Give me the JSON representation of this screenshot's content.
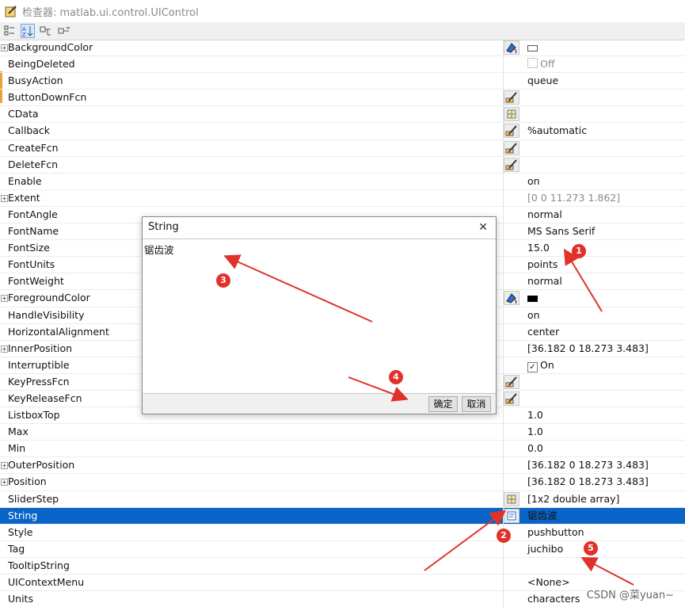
{
  "window": {
    "title": "检查器:  matlab.ui.control.UIControl"
  },
  "properties": [
    {
      "name": "BackgroundColor",
      "expand": true,
      "btn": "color-picker-icon",
      "val": "",
      "swatch": "white"
    },
    {
      "name": "BeingDeleted",
      "check": "off",
      "val": "Off",
      "gray": true
    },
    {
      "name": "BusyAction",
      "val": "queue"
    },
    {
      "name": "ButtonDownFcn",
      "btn": "callback-editor-icon",
      "val": ""
    },
    {
      "name": "CData",
      "btn": "array-editor-icon",
      "val": ""
    },
    {
      "name": "Callback",
      "btn": "callback-editor-icon",
      "val": "%automatic"
    },
    {
      "name": "CreateFcn",
      "btn": "callback-editor-icon",
      "val": ""
    },
    {
      "name": "DeleteFcn",
      "btn": "callback-editor-icon",
      "val": ""
    },
    {
      "name": "Enable",
      "val": "on"
    },
    {
      "name": "Extent",
      "expand": true,
      "val": "[0 0 11.273 1.862]",
      "gray": true
    },
    {
      "name": "FontAngle",
      "val": "normal"
    },
    {
      "name": "FontName",
      "val": "MS Sans Serif"
    },
    {
      "name": "FontSize",
      "val": "15.0"
    },
    {
      "name": "FontUnits",
      "val": "points"
    },
    {
      "name": "FontWeight",
      "val": "normal"
    },
    {
      "name": "ForegroundColor",
      "expand": true,
      "btn": "color-picker-icon",
      "val": "",
      "swatch": "black"
    },
    {
      "name": "HandleVisibility",
      "val": "on"
    },
    {
      "name": "HorizontalAlignment",
      "val": "center"
    },
    {
      "name": "InnerPosition",
      "expand": true,
      "val": "[36.182 0 18.273 3.483]"
    },
    {
      "name": "Interruptible",
      "check": "on",
      "val": "On"
    },
    {
      "name": "KeyPressFcn",
      "btn": "callback-editor-icon",
      "val": ""
    },
    {
      "name": "KeyReleaseFcn",
      "btn": "callback-editor-icon",
      "val": ""
    },
    {
      "name": "ListboxTop",
      "val": "1.0"
    },
    {
      "name": "Max",
      "val": "1.0"
    },
    {
      "name": "Min",
      "val": "0.0"
    },
    {
      "name": "OuterPosition",
      "expand": true,
      "val": "[36.182 0 18.273 3.483]"
    },
    {
      "name": "Position",
      "expand": true,
      "val": "[36.182 0 18.273 3.483]"
    },
    {
      "name": "SliderStep",
      "btn": "array-editor-icon",
      "val": "[1x2  double array]"
    },
    {
      "name": "String",
      "btn": "string-editor-icon",
      "val": "锯齿波",
      "selected": true
    },
    {
      "name": "Style",
      "val": "pushbutton"
    },
    {
      "name": "Tag",
      "val": "juchibo"
    },
    {
      "name": "TooltipString",
      "val": ""
    },
    {
      "name": "UIContextMenu",
      "val": "<None>"
    },
    {
      "name": "Units",
      "val": "characters"
    }
  ],
  "dialog": {
    "title": "String",
    "content": "锯齿波",
    "ok_label": "确定",
    "cancel_label": "取消"
  },
  "annotations": {
    "markers": [
      "1",
      "2",
      "3",
      "4",
      "5"
    ],
    "color": "#e0312b"
  },
  "watermark": "CSDN @菜yuan~",
  "colors": {
    "selection": "#0a64c8",
    "annotation": "#e0312b"
  }
}
